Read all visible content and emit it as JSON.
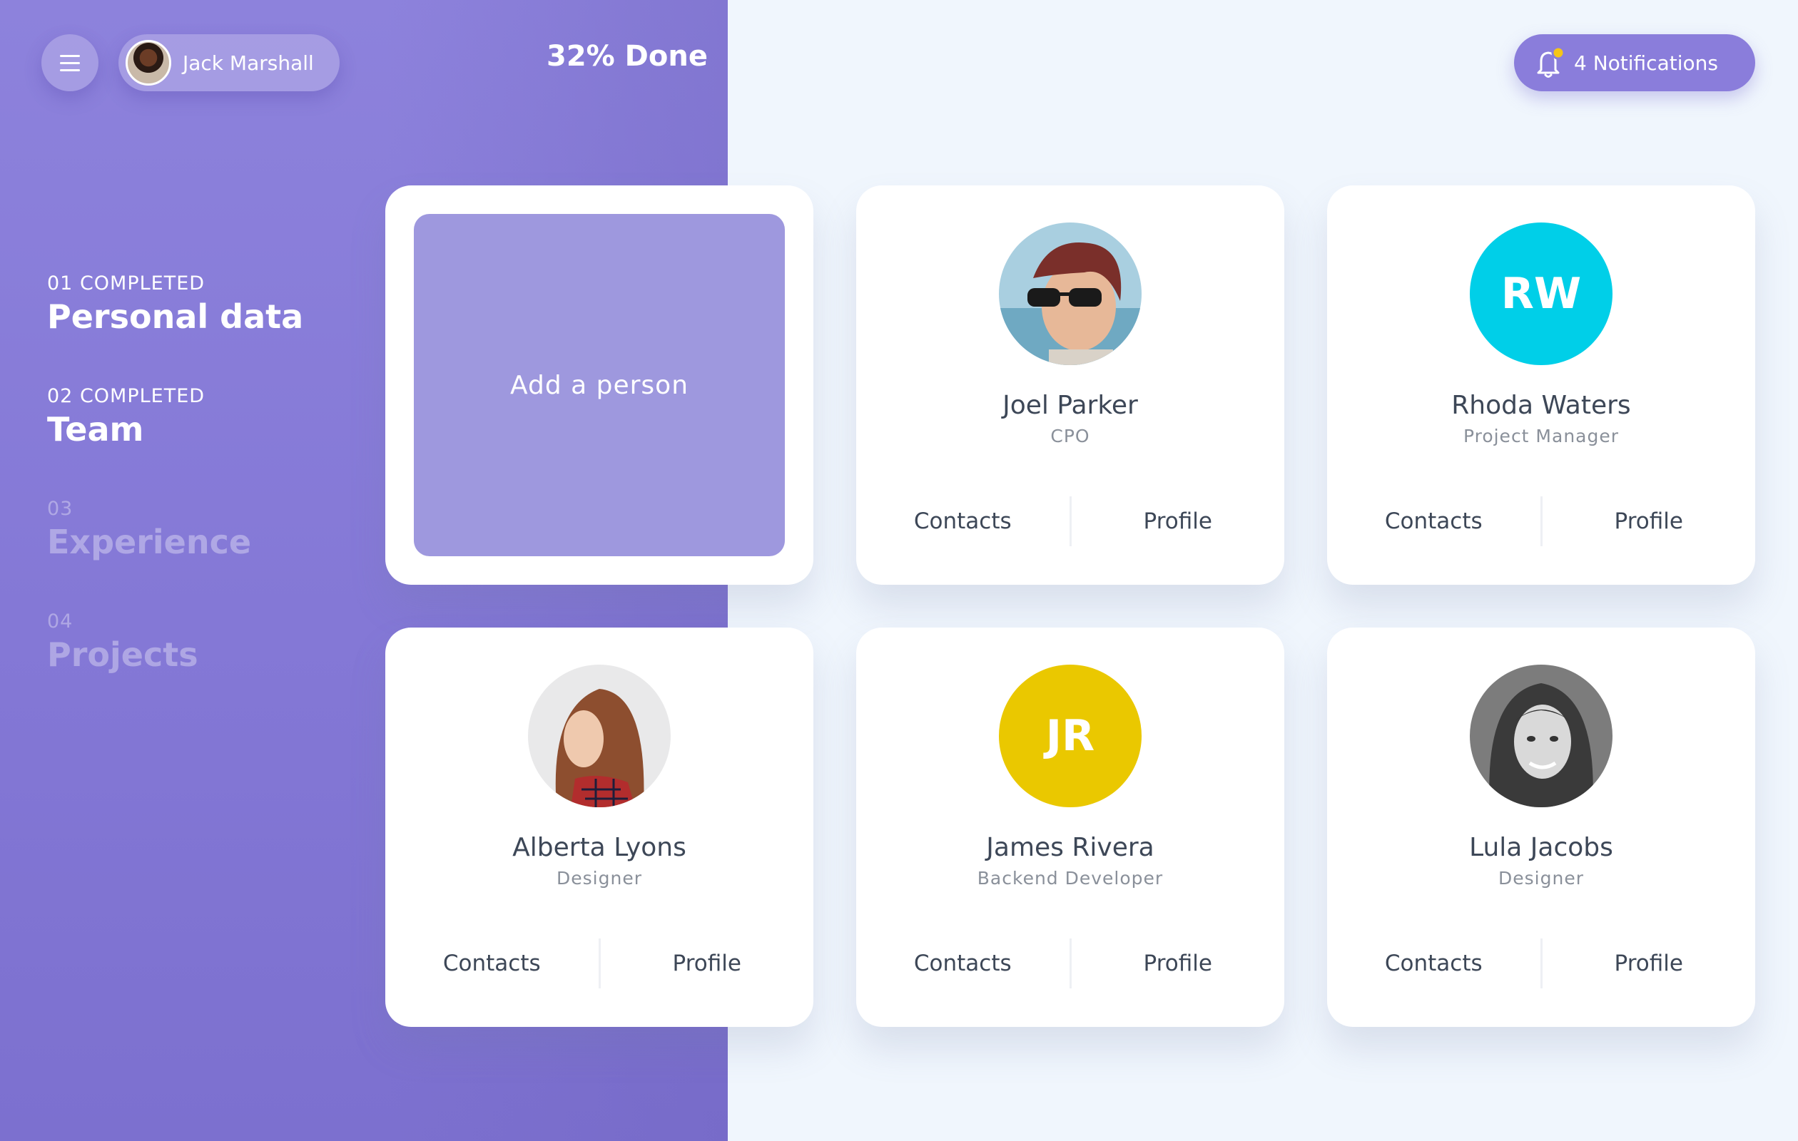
{
  "header": {
    "user_name": "Jack Marshall",
    "progress_label": "32% Done",
    "progress_percent": 32,
    "notifications_label": "4 Notifications",
    "accent": "#8a7ddb",
    "notification_dot": "#f5c518"
  },
  "steps": [
    {
      "label": "01 COMPLETED",
      "title": "Personal data",
      "completed": true
    },
    {
      "label": "02 COMPLETED",
      "title": "Team",
      "completed": true
    },
    {
      "label": "03",
      "title": "Experience",
      "completed": false
    },
    {
      "label": "04",
      "title": "Projects",
      "completed": false
    }
  ],
  "add_card": {
    "label": "Add a person"
  },
  "people": [
    {
      "name": "Joel Parker",
      "role": "CPO",
      "initials": "",
      "color": "",
      "contacts": "Contacts",
      "profile": "Profile"
    },
    {
      "name": "Rhoda Waters",
      "role": "Project Manager",
      "initials": "RW",
      "color": "#00cfe8",
      "contacts": "Contacts",
      "profile": "Profile"
    },
    {
      "name": "Alberta Lyons",
      "role": "Designer",
      "initials": "",
      "color": "",
      "contacts": "Contacts",
      "profile": "Profile"
    },
    {
      "name": "James Rivera",
      "role": "Backend Developer",
      "initials": "JR",
      "color": "#eac800",
      "contacts": "Contacts",
      "profile": "Profile"
    },
    {
      "name": "Lula Jacobs",
      "role": "Designer",
      "initials": "",
      "color": "",
      "contacts": "Contacts",
      "profile": "Profile"
    }
  ]
}
